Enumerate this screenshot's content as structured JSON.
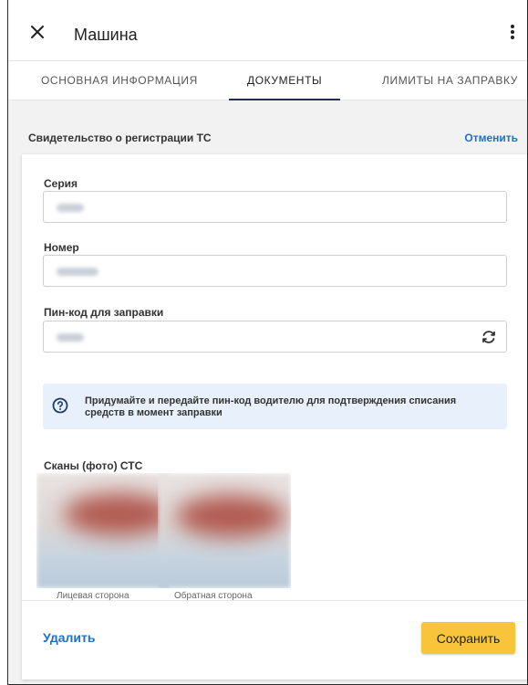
{
  "header": {
    "title": "Машина",
    "close_icon": "close-icon",
    "menu_icon": "more-vertical-icon"
  },
  "tabs": [
    {
      "label": "ОСНОВНАЯ ИНФОРМАЦИЯ",
      "active": false
    },
    {
      "label": "ДОКУМЕНТЫ",
      "active": true
    },
    {
      "label": "ЛИМИТЫ НА ЗАПРАВКУ",
      "active": false
    }
  ],
  "section": {
    "title": "Свидетельство о регистрации ТС",
    "cancel_label": "Отменить"
  },
  "fields": {
    "series_label": "Серия",
    "number_label": "Номер",
    "pin_label": "Пин-код для заправки",
    "refresh_icon": "refresh-icon"
  },
  "info": {
    "text": "Придумайте и передайте пин-код водителю для подтверждения списания средств в момент заправки",
    "icon": "help-icon"
  },
  "scans": {
    "title": "Сканы (фото) СТС",
    "front_caption": "Лицевая сторона",
    "back_caption": "Обратная сторона"
  },
  "footer": {
    "delete_label": "Удалить",
    "save_label": "Сохранить"
  },
  "colors": {
    "accent_link": "#1f6fd1",
    "save_button": "#f8c53a",
    "info_bg": "#e8f1fb",
    "tab_indicator": "#27304a"
  }
}
